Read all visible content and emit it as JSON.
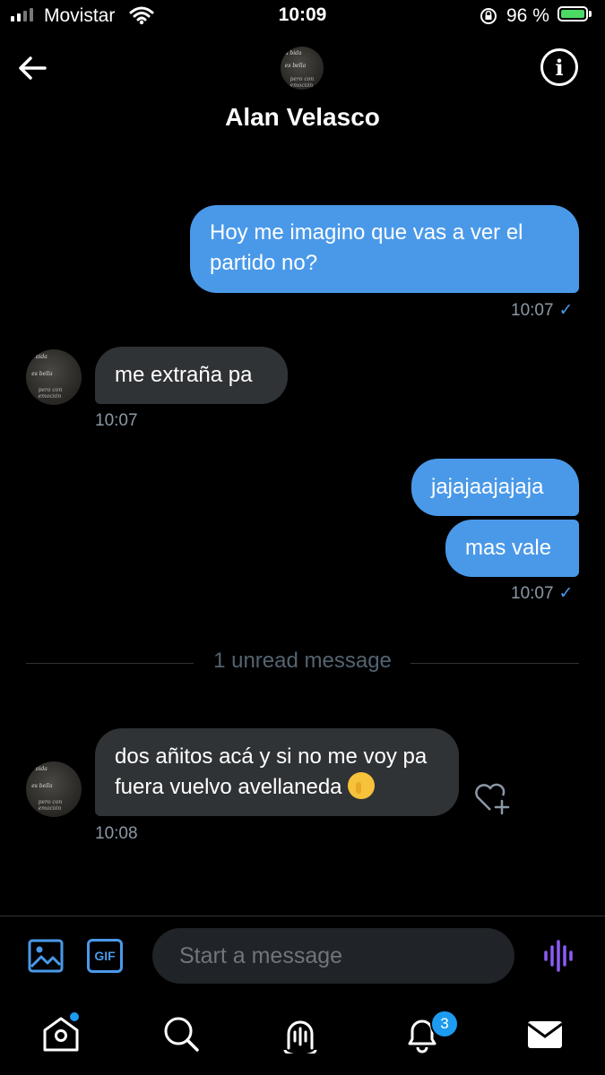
{
  "status_bar": {
    "carrier": "Movistar",
    "time": "10:09",
    "battery_percent": "96 %",
    "battery_level": 0.96
  },
  "header": {
    "contact_name": "Alan Velasco",
    "avatar_lines": [
      "La bida",
      "es bella",
      "pero con emoción"
    ]
  },
  "messages": [
    {
      "direction": "outgoing",
      "text": "Hoy me imagino que vas a ver el partido no?",
      "time": "10:07",
      "status_icon": "check-icon"
    },
    {
      "direction": "incoming",
      "text": "me extraña pa",
      "time": "10:07"
    },
    {
      "direction": "outgoing",
      "text": "jajajaajajaja"
    },
    {
      "direction": "outgoing",
      "text": "mas vale",
      "time": "10:07",
      "status_icon": "check-icon"
    },
    {
      "direction": "incoming",
      "text": "dos añitos acá y si no me voy pa fuera vuelvo avellaneda",
      "emoji": "shushing-face",
      "time": "10:08"
    }
  ],
  "unread_divider": "1 unread message",
  "composer": {
    "placeholder": "Start a message",
    "gif_label": "GIF"
  },
  "nav": {
    "notifications_badge": "3"
  },
  "colors": {
    "background": "#000000",
    "outgoing_bubble": "#4a99e9",
    "incoming_bubble": "#2f3336",
    "accent": "#1d9bf0",
    "voice_accent": "#8b5cf6",
    "muted_text": "#8b98a5"
  }
}
